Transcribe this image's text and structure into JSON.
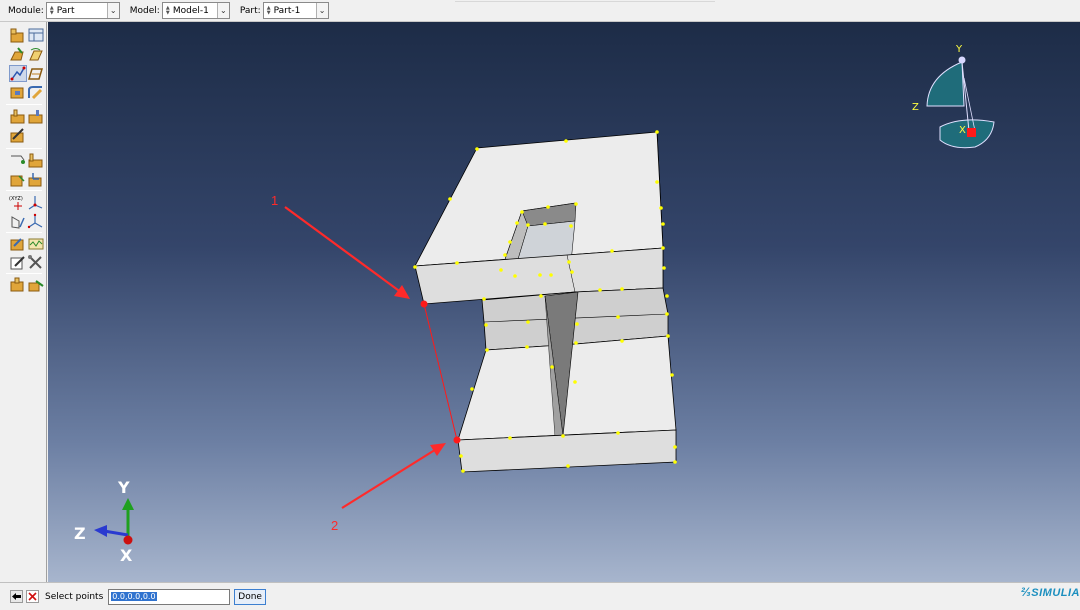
{
  "context_bar": {
    "module_label": "Module:",
    "module_value": "Part",
    "model_label": "Model:",
    "model_value": "Model-1",
    "part_label": "Part:",
    "part_value": "Part-1"
  },
  "toolbox": {
    "icons": [
      "create-part-icon",
      "part-manager-icon",
      "create-solid-extrude-icon",
      "create-solid-revolve-icon",
      "create-wire-icon",
      "create-shell-icon",
      "create-cut-icon",
      "create-round-icon",
      "partition-face-icon",
      "partition-cell-icon",
      "edit-feature-icon",
      "datum-point-icon",
      "datum-axis-icon",
      "datum-plane-icon",
      "datum-csys-icon",
      "create-point-xyz-icon",
      "create-axis-icon",
      "create-plane-icon",
      "create-csys-icon",
      "sketch-icon",
      "query-icon",
      "edit-icon",
      "repair-tools-icon",
      "reference-point-icon",
      "assembly-icon"
    ]
  },
  "viewport": {
    "annotations": {
      "label_1": "1",
      "label_2": "2"
    },
    "triad": {
      "y": "Y",
      "z": "Z",
      "x": "X"
    },
    "view_cube": {
      "y": "Y",
      "z": "Z",
      "x": "X"
    }
  },
  "prompt_bar": {
    "back_icon": "arrow-left-icon",
    "cancel_icon": "close-icon",
    "label": "Select points",
    "input_value": "0.0,0.0,0.0",
    "done_label": "Done"
  },
  "brand": "SIMULIA",
  "colors": {
    "viewport_top": "#1d2c47",
    "viewport_bottom": "#a7b5cd",
    "part_face": "#ececec",
    "vertex_marker": "#ffff00",
    "selection": "#ff1a1a"
  }
}
